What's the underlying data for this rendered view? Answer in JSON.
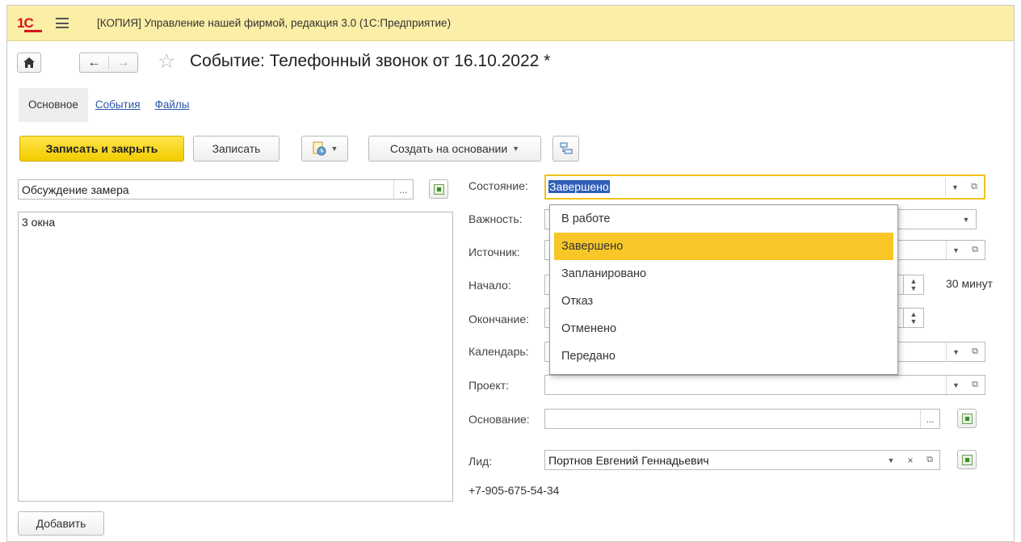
{
  "window": {
    "app_title": "[КОПИЯ] Управление нашей фирмой, редакция 3.0  (1С:Предприятие)",
    "logo_text": "1С"
  },
  "nav": {
    "page_title": "Событие: Телефонный звонок от 16.10.2022 *",
    "home_icon": "home-icon",
    "back_icon": "arrow-left-icon",
    "forward_icon": "arrow-right-icon",
    "favorite_icon": "star-icon"
  },
  "tabs": [
    {
      "label": "Основное",
      "active": true
    },
    {
      "label": "События",
      "active": false
    },
    {
      "label": "Файлы",
      "active": false
    }
  ],
  "toolbar": {
    "save_close": "Записать и закрыть",
    "save": "Записать",
    "create_based_on": "Создать на основании"
  },
  "left": {
    "subject": "Обсуждение замера",
    "subject_ellipsis": "...",
    "content": "3 окна",
    "add_button": "Добавить"
  },
  "form": {
    "state_label": "Состояние:",
    "state_value": "Завершено",
    "importance_label": "Важность:",
    "source_label": "Источник:",
    "start_label": "Начало:",
    "end_label": "Окончание:",
    "duration": "30 минут",
    "calendar_label": "Календарь:",
    "project_label": "Проект:",
    "basis_label": "Основание:",
    "basis_ellipsis": "...",
    "lead_label": "Лид:",
    "lead_value": "Портнов Евгений Геннадьевич",
    "phone": "+7-905-675-54-34"
  },
  "state_dropdown": {
    "options": [
      "В работе",
      "Завершено",
      "Запланировано",
      "Отказ",
      "Отменено",
      "Передано"
    ],
    "selected_index": 1
  },
  "colors": {
    "titlebar": "#fbeea6",
    "primary_button": "#f2cc00",
    "selected_option": "#f8c727",
    "link": "#2a57a8",
    "text_selection": "#2f5fb8"
  }
}
